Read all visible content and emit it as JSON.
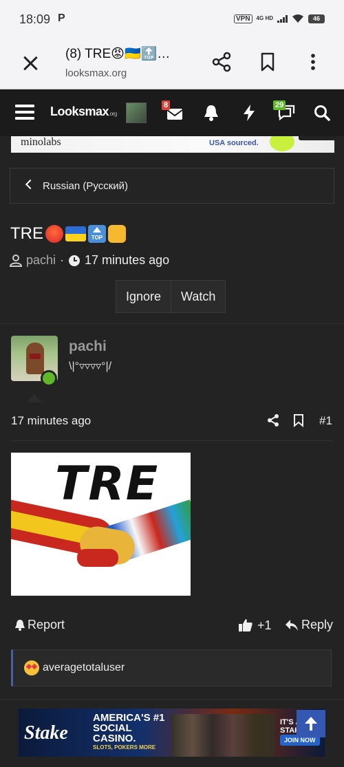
{
  "status_bar": {
    "time": "18:09",
    "notification": "P",
    "vpn": "VPN",
    "network": "4G HD",
    "battery": "46"
  },
  "browser": {
    "tab_title": "(8) TRE😡🇺🇦🔝…",
    "url": "looksmax.org"
  },
  "site_header": {
    "logo": "Looksmax",
    "logo_suffix": ".org",
    "inbox_count": "8",
    "alerts_count": "29"
  },
  "ad_strip": {
    "brand": "minolabs",
    "text": "USA sourced."
  },
  "breadcrumb": {
    "label": "Russian (Русский)"
  },
  "thread": {
    "title": "TRE",
    "author": "pachi",
    "time": "17 minutes ago"
  },
  "thread_actions": {
    "ignore": "Ignore",
    "watch": "Watch"
  },
  "post": {
    "username": "pachi",
    "user_title": "\\|°▿▿▿▿°|/",
    "time": "17 minutes ago",
    "number": "#1",
    "image_text": "TRE",
    "report_label": "Report",
    "like_label": "+1",
    "reply_label": "Reply",
    "reactor": "averagetotaluser"
  },
  "bottom_ad": {
    "brand": "Stake",
    "headline": "AMERICA'S #1 SOCIAL CASINO.",
    "subline": "SLOTS, POKERS MORE",
    "tag": "IT'S ALL AT STAKE",
    "button": "JOIN NOW"
  },
  "colors": {
    "background": "#232323",
    "header": "#1b1b1b",
    "accent": "#4661a8",
    "online": "#5fb82a"
  }
}
